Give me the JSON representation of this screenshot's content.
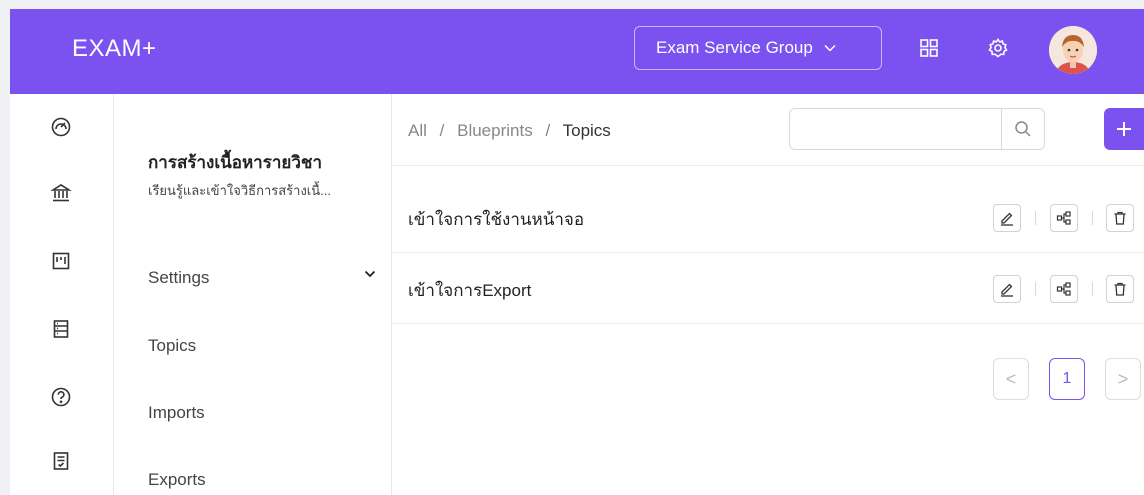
{
  "header": {
    "brand": "EXAM+",
    "group_selector": "Exam Service Group",
    "colors": {
      "primary": "#7b51f0"
    }
  },
  "rail": {
    "icons": [
      "dashboard-icon",
      "bank-icon",
      "board-icon",
      "list-icon",
      "help-icon",
      "document-icon"
    ]
  },
  "subnav": {
    "course_title": "การสร้างเนื้อหารายวิชา",
    "course_desc": "เรียนรู้และเข้าใจวิธีการสร้างเนื้...",
    "items": [
      {
        "label": "Settings"
      },
      {
        "label": "Topics"
      },
      {
        "label": "Imports"
      },
      {
        "label": "Exports"
      }
    ]
  },
  "breadcrumb": {
    "root": "All",
    "sep": "/",
    "parent": "Blueprints",
    "current": "Topics"
  },
  "search": {
    "value": "",
    "placeholder": ""
  },
  "topics": [
    {
      "name": "เข้าใจการใช้งานหน้าจอ"
    },
    {
      "name": "เข้าใจการExport"
    }
  ],
  "pagination": {
    "prev": "<",
    "current": "1",
    "next": ">"
  }
}
